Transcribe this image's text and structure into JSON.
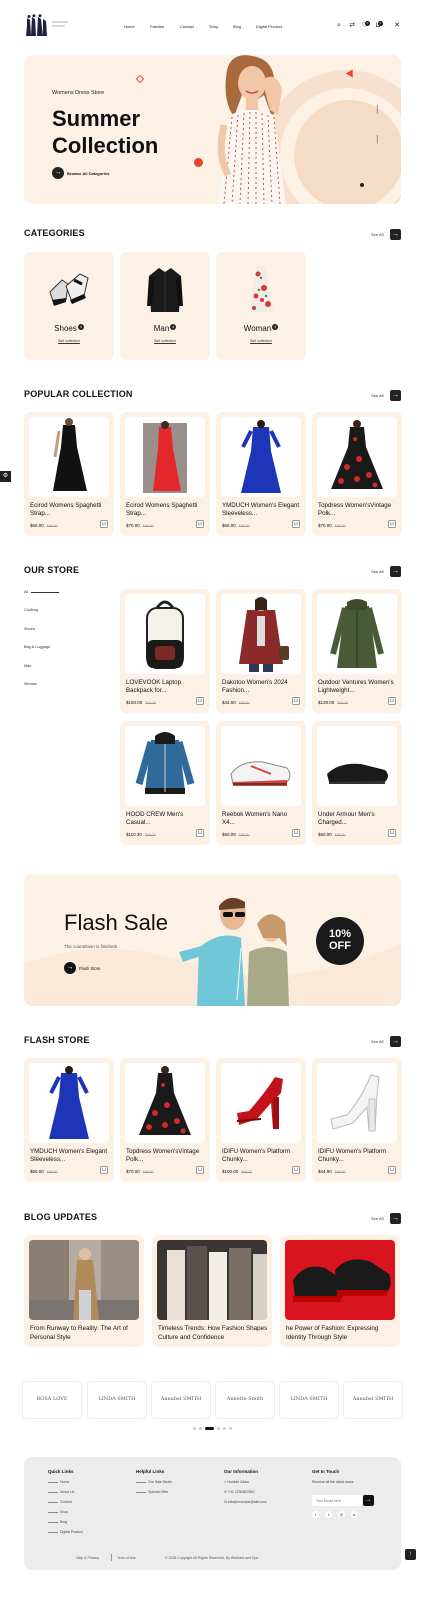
{
  "header": {
    "nav": [
      "Home",
      "Fashion",
      "Contact",
      "Shop",
      "Blog",
      "Digital Product"
    ],
    "wishlist_count": "0",
    "cart_count": "0"
  },
  "hero": {
    "eyebrow": "Womens Dress Store",
    "title_line1": "Summer",
    "title_line2": "Collection",
    "cta": "Browse All Categories"
  },
  "categories": {
    "title": "CATEGORIES",
    "see_all": "See All",
    "items": [
      {
        "name": "Shoes",
        "count": "4",
        "link": "See collection"
      },
      {
        "name": "Man",
        "count": "4",
        "link": "See collection"
      },
      {
        "name": "Woman",
        "count": "4",
        "link": "See collection"
      }
    ]
  },
  "popular": {
    "title": "POPULAR COLLECTION",
    "see_all": "See All",
    "items": [
      {
        "name": "Ecirod Womens Spaghetti Strap...",
        "price": "$60.00",
        "old": "$99.00"
      },
      {
        "name": "Ecirod Womens Spaghetti Strap...",
        "price": "$70.00",
        "old": "$99.00"
      },
      {
        "name": "YMDUCH Women's Elegant Sleeveless...",
        "price": "$60.00",
        "old": "$89.00"
      },
      {
        "name": "Topdress Women'sVintage Polk...",
        "price": "$70.00",
        "old": "$89.00"
      }
    ]
  },
  "store": {
    "title": "OUR STORE",
    "see_all": "See All",
    "sidebar": [
      "All",
      "Clothing",
      "Shoes",
      "Bag & Luggage",
      "Man",
      "Woman"
    ],
    "items": [
      {
        "name": "LOVEVOOK Laptop Backpack for...",
        "price": "$160.00",
        "old": "$99.00"
      },
      {
        "name": "Dakotoo Women's 2024 Fashion...",
        "price": "$44.50",
        "old": "$89.00"
      },
      {
        "name": "Outdoor Ventures Women's Lightweight...",
        "price": "$128.00",
        "old": "$89.00"
      },
      {
        "name": "HOOD CREW Men's Casual...",
        "price": "$110.30",
        "old": "$99.00"
      },
      {
        "name": "Reebok Women's Nano X4...",
        "price": "$50.09",
        "old": "$89.00"
      },
      {
        "name": "Under Armour Men's Charged...",
        "price": "$60.00",
        "old": "$89.00"
      }
    ]
  },
  "flash_banner": {
    "title": "Flash Sale",
    "subtitle": "The countdown is finished!",
    "cta": "Flash Store",
    "badge_line1": "10%",
    "badge_line2": "OFF"
  },
  "flash_store": {
    "title": "FLASH STORE",
    "see_all": "See All",
    "items": [
      {
        "name": "YMDUCH Women's Elegant Sleeveless...",
        "price": "$60.00",
        "old": "$89.00"
      },
      {
        "name": "Topdress Women'sVintage Polk...",
        "price": "$70.00",
        "old": "$89.00"
      },
      {
        "name": "IDIFU Women's Platform Chunky...",
        "price": "$100.00",
        "old": "$89.00"
      },
      {
        "name": "IDIFU Women's Platform Chunky...",
        "price": "$44.90",
        "old": "$89.00"
      }
    ]
  },
  "blog": {
    "title": "BLOG UPDATES",
    "see_all": "See All",
    "items": [
      {
        "title": "From Runway to Reality: The Art of Personal Style"
      },
      {
        "title": "Timeless Trends: How Fashion Shapes Culture and Confidence"
      },
      {
        "title": "he Power of Fashion: Expressing Identity Through Style"
      }
    ]
  },
  "brands": [
    "ROSA LOVE",
    "LINDA SMITH",
    "Annabel SMITH",
    "Annette Smith",
    "LINDA SMITH",
    "Annabel SMITH"
  ],
  "footer": {
    "quick_title": "Quick Links",
    "quick_links": [
      "Home",
      "About Us",
      "Contact",
      "Shop",
      "Blog",
      "Digital Product"
    ],
    "helpful_title": "Helpful Links",
    "helpful_links": [
      "Our Sale Deals",
      "Special Offer"
    ],
    "info_title": "Our Information",
    "info": [
      "Humble Zaika",
      "+91 1234567890",
      "info@example@site.com"
    ],
    "touch_title": "Get In Touch",
    "touch_text": "Receive all the latest news",
    "email_placeholder": "Your Email here",
    "bottom_left": "Help & Privacy",
    "bottom_mid": "Term of Use",
    "copyright": "© 2025 Copyright All Rights Reserved. By Webbies and Spa"
  }
}
